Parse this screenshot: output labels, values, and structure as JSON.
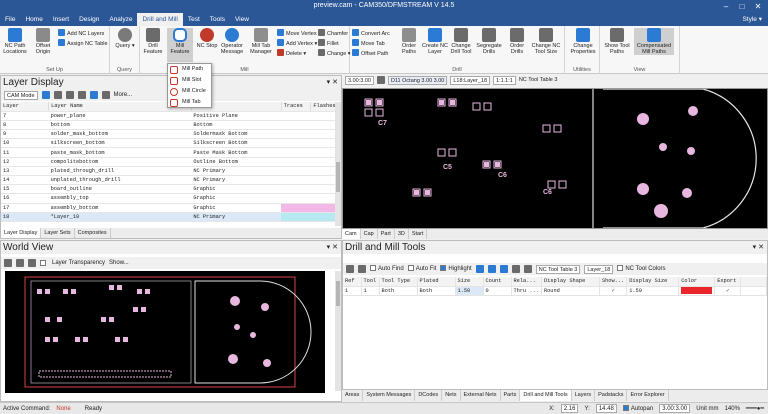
{
  "window": {
    "title": "preview.cam - CAM350/DFMSTREAM V 14.5",
    "controls": [
      "–",
      "□",
      "✕"
    ]
  },
  "menu": {
    "items": [
      "File",
      "Home",
      "Insert",
      "Design",
      "Analyze",
      "Drill and Mill",
      "Test",
      "Tools",
      "View"
    ],
    "active": "Drill and Mill",
    "style_label": "Style"
  },
  "ribbon": {
    "groups": [
      {
        "label": "Set Up"
      },
      {
        "label": "Query"
      },
      {
        "label": "Mill"
      },
      {
        "label": "Drill"
      },
      {
        "label": "Utilities"
      },
      {
        "label": "View"
      }
    ],
    "nc_paths_label": "NC Path Locations",
    "offset_origin_label": "Offset Origin",
    "add_nc_layers_label": "Add NC Layers",
    "assign_nc_table_label": "Assign NC Table",
    "query_label": "Query",
    "drill_feature_label": "Drill Feature",
    "mill_feature_label": "Mill Feature",
    "nc_stop_label": "NC Stop",
    "operator_message_label": "Operator Message",
    "mill_tab_manager_label": "Mill Tab Manager",
    "move_vertex_label": "Move Vertex",
    "add_vertex_label": "Add Vertex",
    "delete_label": "Delete",
    "chamfer_label": "Chamfer",
    "fillet_label": "Fillet",
    "change_label": "Change",
    "convert_arc_label": "Convert Arc",
    "move_tab_label": "Move Tab",
    "offset_path_label": "Offset Path",
    "order_paths_label": "Order Paths",
    "create_nc_layer_label": "Create NC Layer",
    "change_drill_tool_label": "Change Drill Tool",
    "segregate_drills_label": "Segregate Drills",
    "order_drills_label": "Order Drills",
    "change_nc_tool_size_label": "Change NC Tool Size",
    "change_properties_label": "Change Properties",
    "show_tool_paths_label": "Show Tool Paths",
    "compensated_mill_paths_label": "Compensated Mill Paths"
  },
  "mill_dropdown": {
    "items": [
      "Mill Path",
      "Mill Slot",
      "Mill Circle",
      "Mill Tab"
    ]
  },
  "layer_display": {
    "title": "Layer Display",
    "mode": "CAM Mode",
    "more_label": "More...",
    "columns": [
      "Layer",
      "Layer Name",
      "Type",
      "Traces",
      "Flashes"
    ],
    "rows": [
      {
        "layer": "7",
        "name": "power_plane",
        "type": "Positive Plane",
        "traces": "",
        "flashes": ""
      },
      {
        "layer": "8",
        "name": "bottom",
        "type": "Bottom",
        "traces": "",
        "flashes": ""
      },
      {
        "layer": "9",
        "name": "solder_mask_bottom",
        "type": "Soldermask Bottom",
        "traces": "",
        "flashes": ""
      },
      {
        "layer": "10",
        "name": "silkscreen_bottom",
        "type": "Silkscreen Bottom",
        "traces": "",
        "flashes": ""
      },
      {
        "layer": "11",
        "name": "paste_mask_bottom",
        "type": "Paste Mask Bottom",
        "traces": "",
        "flashes": ""
      },
      {
        "layer": "12",
        "name": "compolitebottom",
        "type": "Outline Bottom",
        "traces": "",
        "flashes": ""
      },
      {
        "layer": "13",
        "name": "plated_through_drill",
        "type": "NC Primary",
        "traces": "",
        "flashes": ""
      },
      {
        "layer": "14",
        "name": "unplated_through_drill",
        "type": "NC Primary",
        "traces": "",
        "flashes": ""
      },
      {
        "layer": "15",
        "name": "board_outline",
        "type": "Graphic",
        "traces": "",
        "flashes": ""
      },
      {
        "layer": "16",
        "name": "assembly_top",
        "type": "Graphic",
        "traces": "",
        "flashes": ""
      },
      {
        "layer": "17",
        "name": "assembly_bottom",
        "type": "Graphic",
        "traces": "",
        "flashes": ""
      },
      {
        "layer": "18",
        "name": "*Layer_18",
        "type": "NC Primary",
        "traces": "",
        "flashes": ""
      }
    ],
    "tabs": [
      "Layer Display",
      "Layer Sets",
      "Composites"
    ]
  },
  "world_view": {
    "title": "World View",
    "layer_transparency_label": "Layer Transparency",
    "show_label": "Show..."
  },
  "view_toolbar": {
    "grid_value": "3.00:3.00",
    "d_code": "D11",
    "d_code_desc": "Octang 3.00 3.00",
    "layer": "L18:Layer_18",
    "zoom": "1:1.1:1",
    "nc_tool_table": "NC Tool Table 3"
  },
  "view_tabs": [
    "Cam",
    "Cap",
    "Part",
    "3D",
    "Start"
  ],
  "view_tabs_active": "Cam",
  "board_labels": [
    "C7",
    "C6",
    "C5",
    "C8",
    "C6",
    "C1"
  ],
  "drill_mill": {
    "title": "Drill and Mill Tools",
    "auto_find_label": "Auto Find",
    "auto_fit_label": "Auto Fit",
    "highlight_label": "Highlight",
    "nc_table_label": "NC Tool Table 3",
    "layer_label": "Layer_18",
    "nc_tool_colors_label": "NC Tool Colors",
    "columns": [
      "Ref",
      "Tool",
      "Tool Type",
      "Plated",
      "Size",
      "Count",
      "Rela...",
      "Display Shape",
      "Show...",
      "Display Size",
      "Color",
      "Export",
      ""
    ],
    "rows": [
      {
        "ref": "1",
        "tool": "1",
        "type": "Both",
        "plated": "Both",
        "size": "1.50",
        "count": "0",
        "rela": "Thru ...",
        "shape": "Round",
        "show": "✓",
        "dsize": "1.50",
        "color": "#e8262b",
        "export": "✓"
      }
    ]
  },
  "bottom_tabs": [
    "Areas",
    "System Messages",
    "DCodes",
    "Nets",
    "External Nets",
    "Parts",
    "Drill and Mill Tools",
    "Layers",
    "Padstacks",
    "Error Explorer"
  ],
  "bottom_tabs_active": "Drill and Mill Tools",
  "status": {
    "active_command_label": "Active Command:",
    "active_command_value": "None",
    "ready": "Ready",
    "x_label": "X:",
    "x_value": "2.16",
    "y_label": "Y:",
    "y_value": "14.48",
    "autopan_label": "Autopan",
    "grid_value": "3.00:3.00",
    "unit": "Unit mm",
    "zoom_pct": "140%"
  }
}
